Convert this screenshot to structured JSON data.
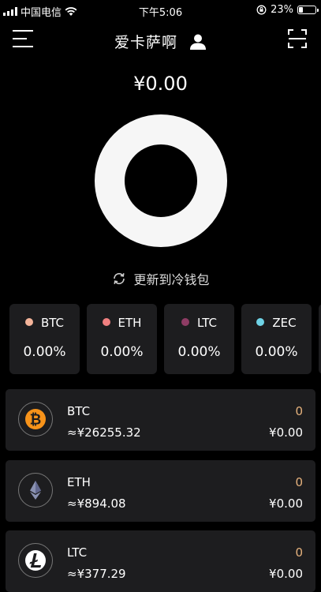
{
  "status_bar": {
    "carrier": "中国电信",
    "time": "下午5:06",
    "battery": "23%",
    "battery_level": 0.23
  },
  "header": {
    "title": "爱卡萨啊"
  },
  "summary": {
    "total": "¥0.00"
  },
  "refresh": {
    "label": "更新到冷钱包"
  },
  "coins": [
    {
      "name": "BTC",
      "percent": "0.00%",
      "color": "#f4b49a"
    },
    {
      "name": "ETH",
      "percent": "0.00%",
      "color": "#f08080"
    },
    {
      "name": "LTC",
      "percent": "0.00%",
      "color": "#8e3c64"
    },
    {
      "name": "ZEC",
      "percent": "0.00%",
      "color": "#6fd3e6"
    }
  ],
  "assets": [
    {
      "symbol": "BTC",
      "price": "≈¥26255.32",
      "quantity": "0",
      "value": "¥0.00",
      "icon": "bitcoin-icon",
      "icon_color": "#f7931a"
    },
    {
      "symbol": "ETH",
      "price": "≈¥894.08",
      "quantity": "0",
      "value": "¥0.00",
      "icon": "ethereum-icon",
      "icon_color": "#8a92b2"
    },
    {
      "symbol": "LTC",
      "price": "≈¥377.29",
      "quantity": "0",
      "value": "¥0.00",
      "icon": "litecoin-icon",
      "icon_color": "#ffffff"
    }
  ]
}
